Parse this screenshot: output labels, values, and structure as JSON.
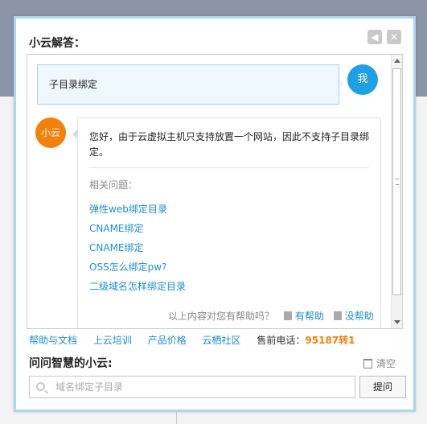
{
  "dialog": {
    "title": "小云解答：",
    "back_icon": "back-icon",
    "close_icon": "close-icon"
  },
  "conversation": {
    "user_label": "我",
    "user_message": "子目录绑定",
    "bot_label": "小云",
    "bot_answer": "您好，由于云虚拟主机只支持放置一个网站，因此不支持子目录绑定。",
    "related_title": "相关问题：",
    "related": [
      "弹性web绑定目录",
      "CNAME绑定",
      "CNAME绑定",
      "OSS怎么绑定pw?",
      "二级域名怎样绑定目录"
    ],
    "feedback_prompt": "以上内容对您有帮助吗？",
    "helpful": "有帮助",
    "not_helpful": "没帮助"
  },
  "footer_links": {
    "help": "帮助与文档",
    "training": "上云培训",
    "price": "产品价格",
    "community": "云栖社区",
    "hotline_label": "售前电话：",
    "hotline": "95187转1"
  },
  "ask": {
    "title": "问问智慧的小云:",
    "clear": "清空",
    "placeholder": "域名绑定子目录",
    "submit": "提问"
  },
  "colors": {
    "accent_blue": "#1ea0e6",
    "bot_orange": "#f4800c",
    "link_blue": "#1f8fd3",
    "border": "#a9d7ef"
  }
}
